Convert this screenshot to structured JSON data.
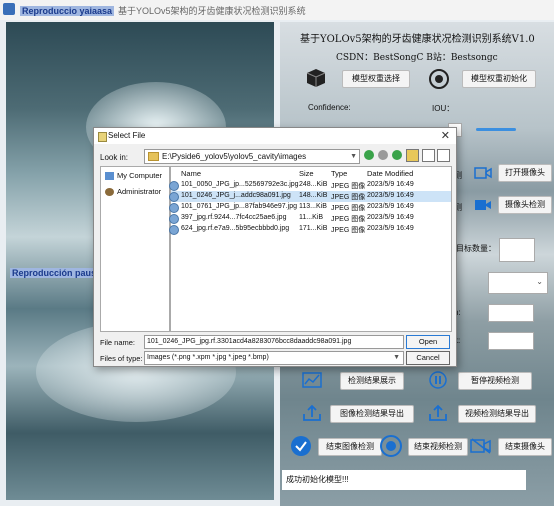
{
  "titlebar": {
    "highlight": "Reproduccio yaiaasa",
    "title": "基于YOLOv5架构的牙齿健康状况检测识别系统"
  },
  "left": {
    "overlay_label": "Reproducción pausada"
  },
  "right": {
    "title": "基于YOLOv5架构的牙齿健康状况检测识别系统V1.0",
    "csdn": "CSDN：BestSongC   B站：Bestsongc",
    "btn_select_model": "模型权重选择",
    "btn_init_model": "模型权重初始化",
    "confidence_label": "Confidence:",
    "iou_label": "IOU：",
    "btn_open_camera": "打开摄像头",
    "btn_camera_detect": "摄像头检测",
    "target_count_label": "目标数量：",
    "btn_show_results": "检测结果展示",
    "btn_pause_video": "暂停视频检测",
    "btn_export_image": "图像检测结果导出",
    "btn_export_video": "视频检测结果导出",
    "btn_end_image": "结束图像检测",
    "btn_end_video": "结束视频检测",
    "btn_end_camera": "结束摄像头",
    "status": "成功初始化模型!!!",
    "partial_label_1": "测",
    "partial_label_2": "测",
    "partial_label_3": "n:",
    "partial_label_4": "x:"
  },
  "dialog": {
    "title": "Select File",
    "look_in_label": "Look in:",
    "look_in_value": "E:\\Pyside6_yolov5\\yolov5_cavity\\images",
    "sidebar": [
      {
        "label": "My Computer",
        "icon": "computer-icon"
      },
      {
        "label": "Administrator",
        "icon": "user-icon"
      }
    ],
    "columns": [
      "Name",
      "Size",
      "Type",
      "Date Modified"
    ],
    "files": [
      {
        "name": "101_0050_JPG_jp...52569792e3c.jpg",
        "size": "248...KiB",
        "type": "JPEG 图像",
        "date": "2023/5/9 16:49"
      },
      {
        "name": "101_0246_JPG_j...addc98a091.jpg",
        "size": "148...KiB",
        "type": "JPEG 图像",
        "date": "2023/5/9 16:49"
      },
      {
        "name": "101_0761_JPG_jp...87fab946e97.jpg",
        "size": "113...KiB",
        "type": "JPEG 图像",
        "date": "2023/5/9 16:49"
      },
      {
        "name": "397_jpg.rf.9244...7fc4cc25ae6.jpg",
        "size": "11...KiB",
        "type": "JPEG 图像",
        "date": "2023/5/9 16:49"
      },
      {
        "name": "624_jpg.rf.e7a9...5b95ecbbbd0.jpg",
        "size": "171...KiB",
        "type": "JPEG 图像",
        "date": "2023/5/9 16:49"
      }
    ],
    "selected_index": 1,
    "file_name_label": "File name:",
    "file_name_value": "101_0246_JPG_jpg.rf.3301acd4a8283076bcc8daaddc98a091.jpg",
    "file_type_label": "Files of type:",
    "file_type_value": "Images (*.png *.xpm *.jpg *.jpeg *.bmp)",
    "open_label": "Open",
    "cancel_label": "Cancel",
    "close_glyph": "✕"
  }
}
